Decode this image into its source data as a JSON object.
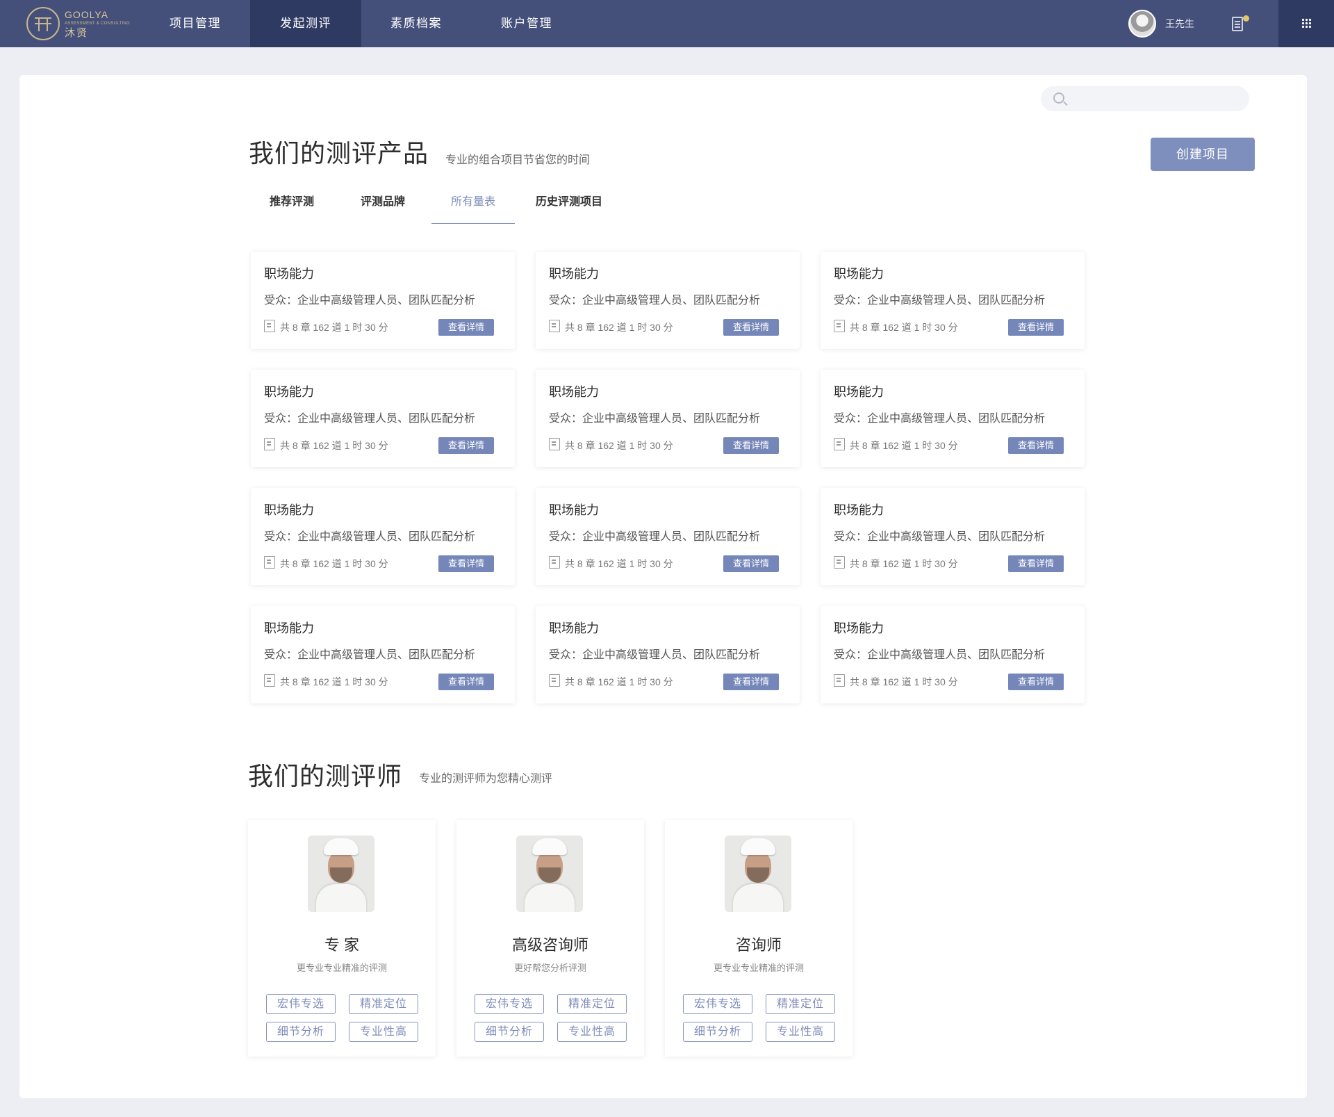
{
  "brand": {
    "name_en": "GOOLYA",
    "name_sub": "ASSESSMENT & CONSULTING",
    "name_cn": "沐贤"
  },
  "nav": {
    "items": [
      {
        "label": "项目管理"
      },
      {
        "label": "发起测评"
      },
      {
        "label": "素质档案"
      },
      {
        "label": "账户管理"
      }
    ],
    "active_index": 1,
    "user_name": "王先生"
  },
  "search": {
    "placeholder": ""
  },
  "products": {
    "title": "我们的测评产品",
    "subtitle": "专业的组合项目节省您的时间",
    "create_button": "创建项目",
    "tabs": [
      {
        "label": "推荐评测"
      },
      {
        "label": "评测品牌"
      },
      {
        "label": "所有量表"
      },
      {
        "label": "历史评测项目"
      }
    ],
    "active_tab": 2,
    "cards": [
      {
        "title": "职场能力",
        "audience": "受众：企业中高级管理人员、团队匹配分析",
        "meta": "共 8 章 162 道 1 时 30 分",
        "button": "查看详情"
      },
      {
        "title": "职场能力",
        "audience": "受众：企业中高级管理人员、团队匹配分析",
        "meta": "共 8 章 162 道 1 时 30 分",
        "button": "查看详情"
      },
      {
        "title": "职场能力",
        "audience": "受众：企业中高级管理人员、团队匹配分析",
        "meta": "共 8 章 162 道 1 时 30 分",
        "button": "查看详情"
      },
      {
        "title": "职场能力",
        "audience": "受众：企业中高级管理人员、团队匹配分析",
        "meta": "共 8 章 162 道 1 时 30 分",
        "button": "查看详情"
      },
      {
        "title": "职场能力",
        "audience": "受众：企业中高级管理人员、团队匹配分析",
        "meta": "共 8 章 162 道 1 时 30 分",
        "button": "查看详情"
      },
      {
        "title": "职场能力",
        "audience": "受众：企业中高级管理人员、团队匹配分析",
        "meta": "共 8 章 162 道 1 时 30 分",
        "button": "查看详情"
      },
      {
        "title": "职场能力",
        "audience": "受众：企业中高级管理人员、团队匹配分析",
        "meta": "共 8 章 162 道 1 时 30 分",
        "button": "查看详情"
      },
      {
        "title": "职场能力",
        "audience": "受众：企业中高级管理人员、团队匹配分析",
        "meta": "共 8 章 162 道 1 时 30 分",
        "button": "查看详情"
      },
      {
        "title": "职场能力",
        "audience": "受众：企业中高级管理人员、团队匹配分析",
        "meta": "共 8 章 162 道 1 时 30 分",
        "button": "查看详情"
      },
      {
        "title": "职场能力",
        "audience": "受众：企业中高级管理人员、团队匹配分析",
        "meta": "共 8 章 162 道 1 时 30 分",
        "button": "查看详情"
      },
      {
        "title": "职场能力",
        "audience": "受众：企业中高级管理人员、团队匹配分析",
        "meta": "共 8 章 162 道 1 时 30 分",
        "button": "查看详情"
      },
      {
        "title": "职场能力",
        "audience": "受众：企业中高级管理人员、团队匹配分析",
        "meta": "共 8 章 162 道 1 时 30 分",
        "button": "查看详情"
      }
    ]
  },
  "assessors": {
    "title": "我们的测评师",
    "subtitle": "专业的测评师为您精心测评",
    "cards": [
      {
        "name": "专 家",
        "desc": "更专业专业精准的评测",
        "tags": [
          "宏伟专选",
          "精准定位",
          "细节分析",
          "专业性高"
        ]
      },
      {
        "name": "高级咨询师",
        "desc": "更好帮您分析评测",
        "tags": [
          "宏伟专选",
          "精准定位",
          "细节分析",
          "专业性高"
        ]
      },
      {
        "name": "咨询师",
        "desc": "更专业专业精准的评测",
        "tags": [
          "宏伟专选",
          "精准定位",
          "细节分析",
          "专业性高"
        ]
      }
    ]
  },
  "colors": {
    "nav_bg": "#45507a",
    "nav_active": "#2f3a63",
    "accent": "#7f8fbd",
    "gold": "#c9b68d"
  },
  "icons": {
    "logo": "goolya-logo-icon",
    "search": "search-icon",
    "notification": "document-icon",
    "apps": "grid-icon",
    "meta": "document-icon"
  }
}
